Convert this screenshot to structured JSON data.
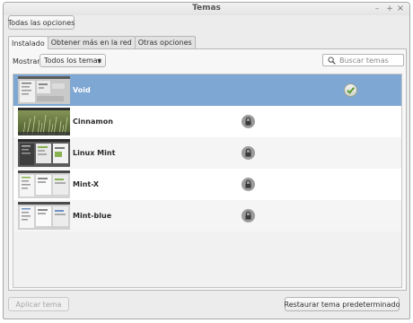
{
  "window": {
    "title": "Temas"
  },
  "toolbar": {
    "all_options_label": "Todas las opciones"
  },
  "tabs": [
    {
      "label": "Instalado",
      "active": true
    },
    {
      "label": "Obtener más en la red",
      "active": false
    },
    {
      "label": "Otras opciones",
      "active": false
    }
  ],
  "filter": {
    "label": "Mostrar",
    "selected": "Todos los temas",
    "search_placeholder": "Buscar temas"
  },
  "themes": [
    {
      "name": "Void",
      "status": "active",
      "selected": true
    },
    {
      "name": "Cinnamon",
      "status": "locked",
      "selected": false
    },
    {
      "name": "Linux Mint",
      "status": "locked",
      "selected": false
    },
    {
      "name": "Mint-X",
      "status": "locked",
      "selected": false
    },
    {
      "name": "Mint-blue",
      "status": "locked",
      "selected": false
    }
  ],
  "footer": {
    "apply_label": "Aplicar tema",
    "restore_label": "Restaurar tema predeterminado"
  },
  "colors": {
    "selection": "#7ea7d3",
    "window_bg": "#ececec",
    "mint_green": "#87b24f"
  }
}
